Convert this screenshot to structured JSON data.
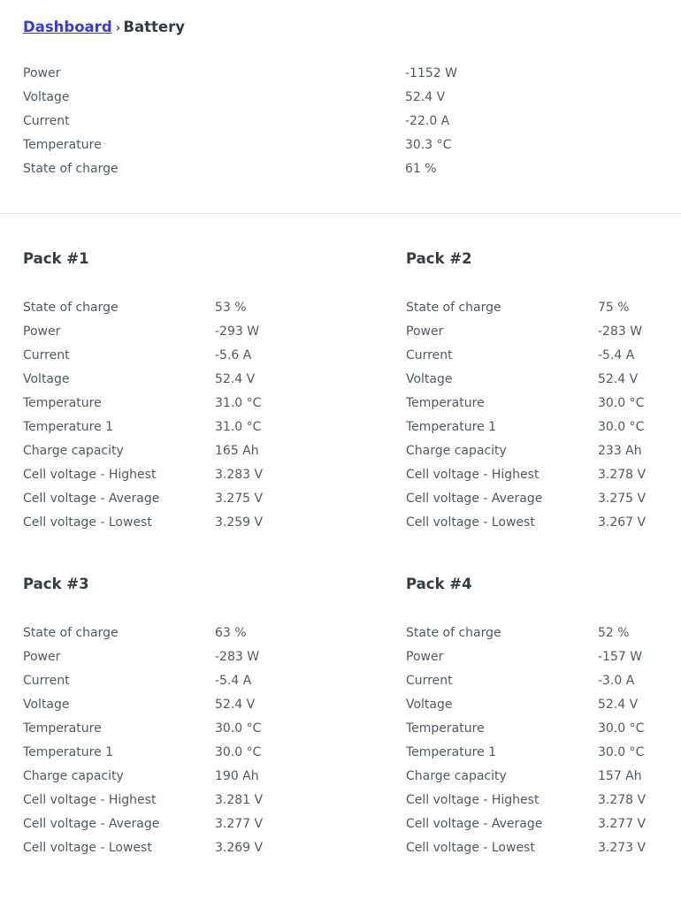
{
  "breadcrumb": {
    "link_label": "Dashboard",
    "separator": "›",
    "current_label": "Battery"
  },
  "summary": {
    "rows": [
      {
        "label": "Power",
        "value": "-1152 W"
      },
      {
        "label": "Voltage",
        "value": "52.4 V"
      },
      {
        "label": "Current",
        "value": "-22.0 A"
      },
      {
        "label": "Temperature",
        "value": "30.3 °C"
      },
      {
        "label": "State of charge",
        "value": "61 %"
      }
    ]
  },
  "packs": [
    {
      "title": "Pack #1",
      "rows": [
        {
          "label": "State of charge",
          "value": "53 %"
        },
        {
          "label": "Power",
          "value": "-293 W"
        },
        {
          "label": "Current",
          "value": "-5.6 A"
        },
        {
          "label": "Voltage",
          "value": "52.4 V"
        },
        {
          "label": "Temperature",
          "value": "31.0 °C"
        },
        {
          "label": "Temperature 1",
          "value": "31.0 °C"
        },
        {
          "label": "Charge capacity",
          "value": "165 Ah"
        },
        {
          "label": "Cell voltage - Highest",
          "value": "3.283 V"
        },
        {
          "label": "Cell voltage - Average",
          "value": "3.275 V"
        },
        {
          "label": "Cell voltage - Lowest",
          "value": "3.259 V"
        }
      ]
    },
    {
      "title": "Pack #2",
      "rows": [
        {
          "label": "State of charge",
          "value": "75 %"
        },
        {
          "label": "Power",
          "value": "-283 W"
        },
        {
          "label": "Current",
          "value": "-5.4 A"
        },
        {
          "label": "Voltage",
          "value": "52.4 V"
        },
        {
          "label": "Temperature",
          "value": "30.0 °C"
        },
        {
          "label": "Temperature 1",
          "value": "30.0 °C"
        },
        {
          "label": "Charge capacity",
          "value": "233 Ah"
        },
        {
          "label": "Cell voltage - Highest",
          "value": "3.278 V"
        },
        {
          "label": "Cell voltage - Average",
          "value": "3.275 V"
        },
        {
          "label": "Cell voltage - Lowest",
          "value": "3.267 V"
        }
      ]
    },
    {
      "title": "Pack #3",
      "rows": [
        {
          "label": "State of charge",
          "value": "63 %"
        },
        {
          "label": "Power",
          "value": "-283 W"
        },
        {
          "label": "Current",
          "value": "-5.4 A"
        },
        {
          "label": "Voltage",
          "value": "52.4 V"
        },
        {
          "label": "Temperature",
          "value": "30.0 °C"
        },
        {
          "label": "Temperature 1",
          "value": "30.0 °C"
        },
        {
          "label": "Charge capacity",
          "value": "190 Ah"
        },
        {
          "label": "Cell voltage - Highest",
          "value": "3.281 V"
        },
        {
          "label": "Cell voltage - Average",
          "value": "3.277 V"
        },
        {
          "label": "Cell voltage - Lowest",
          "value": "3.269 V"
        }
      ]
    },
    {
      "title": "Pack #4",
      "rows": [
        {
          "label": "State of charge",
          "value": "52 %"
        },
        {
          "label": "Power",
          "value": "-157 W"
        },
        {
          "label": "Current",
          "value": "-3.0 A"
        },
        {
          "label": "Voltage",
          "value": "52.4 V"
        },
        {
          "label": "Temperature",
          "value": "30.0 °C"
        },
        {
          "label": "Temperature 1",
          "value": "30.0 °C"
        },
        {
          "label": "Charge capacity",
          "value": "157 Ah"
        },
        {
          "label": "Cell voltage - Highest",
          "value": "3.278 V"
        },
        {
          "label": "Cell voltage - Average",
          "value": "3.277 V"
        },
        {
          "label": "Cell voltage - Lowest",
          "value": "3.273 V"
        }
      ]
    }
  ],
  "colors": {
    "link": "#3a3ad6",
    "heading": "#343c44",
    "text": "#4e5a64",
    "divider": "#ececec",
    "background": "#ffffff"
  }
}
